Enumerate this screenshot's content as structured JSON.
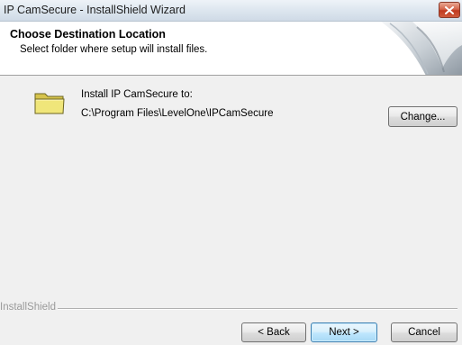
{
  "window": {
    "title": "IP CamSecure - InstallShield Wizard",
    "close_symbol": "✕"
  },
  "header": {
    "title": "Choose Destination Location",
    "subtitle": "Select folder where setup will install files."
  },
  "body": {
    "install_label": "Install IP CamSecure to:",
    "install_path": "C:\\Program Files\\LevelOne\\IPCamSecure",
    "change_button": "Change..."
  },
  "footer": {
    "brand": "InstallShield",
    "back_button": "< Back",
    "next_button": "Next >",
    "cancel_button": "Cancel"
  },
  "icons": {
    "close": "close-icon",
    "folder": "folder-icon",
    "header_graphic": "wizard-header-graphic"
  },
  "colors": {
    "close_button": "#c0391f",
    "folder": "#e8dc6a",
    "default_button_border": "#3c7fb1"
  }
}
